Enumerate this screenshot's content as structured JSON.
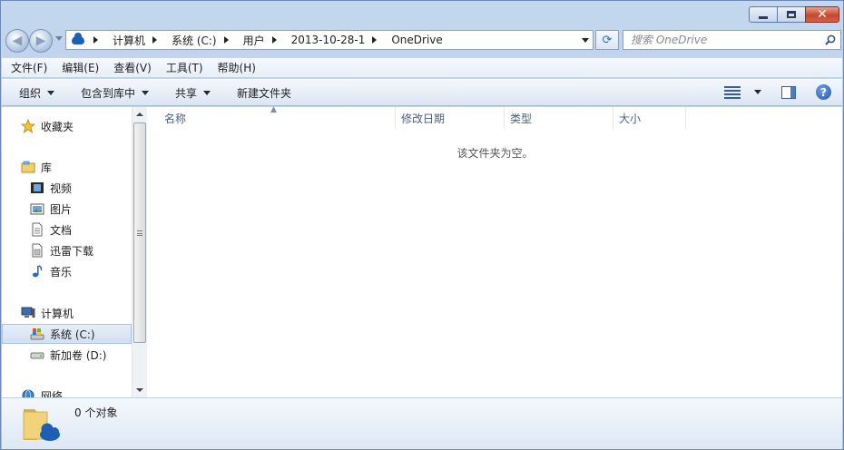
{
  "window": {
    "colors": {
      "accent": "#1d5fb5",
      "close": "#c7472c"
    }
  },
  "address": {
    "breadcrumbs": [
      "计算机",
      "系统 (C:)",
      "用户",
      "2013-10-28-1",
      "OneDrive"
    ]
  },
  "search": {
    "placeholder": "搜索 OneDrive"
  },
  "menu": [
    "文件(F)",
    "编辑(E)",
    "查看(V)",
    "工具(T)",
    "帮助(H)"
  ],
  "commands": {
    "organize": "组织",
    "include_in_library": "包含到库中",
    "share": "共享",
    "new_folder": "新建文件夹"
  },
  "sidebar": {
    "favorites": "收藏夹",
    "library": "库",
    "library_items": [
      "视频",
      "图片",
      "文档",
      "迅雷下载",
      "音乐"
    ],
    "computer": "计算机",
    "computer_items": [
      "系统 (C:)",
      "新加卷 (D:)"
    ],
    "network": "网络"
  },
  "columns": [
    "名称",
    "修改日期",
    "类型",
    "大小"
  ],
  "content": {
    "empty_message": "该文件夹为空。"
  },
  "details": {
    "status": "0 个对象"
  }
}
